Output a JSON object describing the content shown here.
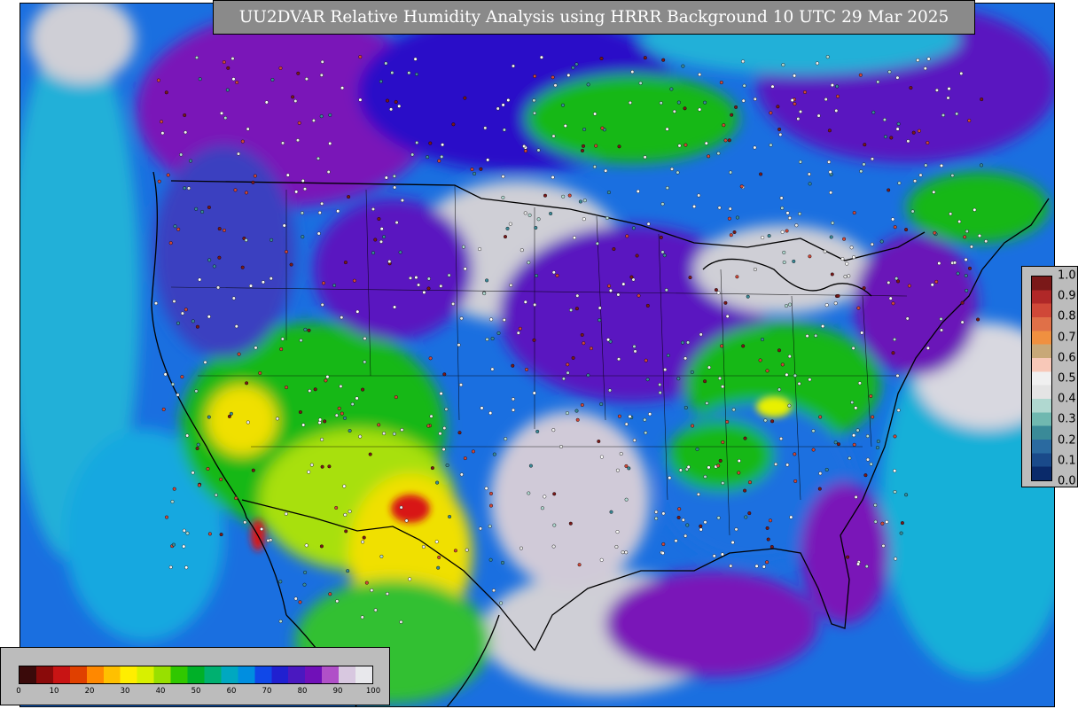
{
  "title": "UU2DVAR Relative Humidity Analysis using HRRR Background 10 UTC 29 Mar 2025",
  "map": {
    "variable": "relative humidity",
    "colors": {
      "ocean_blue": "#1a6fe0",
      "ocean_cyan": "#20b0d8",
      "coast_light": "#cfcfd6",
      "moist_purple": "#7a16b8",
      "deep_purple": "#2a10c8",
      "green": "#18b818",
      "yellow_green": "#a8e010",
      "yellow": "#f0e000",
      "red": "#d81818",
      "border": "#000000"
    }
  },
  "rh_colorbar": {
    "ticks": [
      "0",
      "10",
      "20",
      "30",
      "40",
      "50",
      "60",
      "70",
      "80",
      "90",
      "100"
    ],
    "colors": [
      "#3a0a0a",
      "#8a0a0a",
      "#c81414",
      "#e04000",
      "#ff8800",
      "#ffc000",
      "#ffee00",
      "#d8f000",
      "#98e000",
      "#30c800",
      "#00b028",
      "#00b070",
      "#00a8c0",
      "#008ee0",
      "#1048e8",
      "#2020d0",
      "#4a18c0",
      "#7010b8",
      "#b050c8",
      "#d8c8e0",
      "#e8e8ec"
    ]
  },
  "weight_colorbar": {
    "ticks": [
      "1.0",
      "0.9",
      "0.8",
      "0.7",
      "0.6",
      "0.5",
      "0.4",
      "0.3",
      "0.2",
      "0.1",
      "0.0"
    ],
    "colors": [
      "#7a1818",
      "#b02828",
      "#d04838",
      "#e07048",
      "#f09040",
      "#c8a878",
      "#f8c8b8",
      "#f0f0f0",
      "#e4e4e4",
      "#b0d8d0",
      "#70b8b0",
      "#3a8a98",
      "#2a6aa0",
      "#1a4a8a",
      "#0a2a6a"
    ]
  }
}
